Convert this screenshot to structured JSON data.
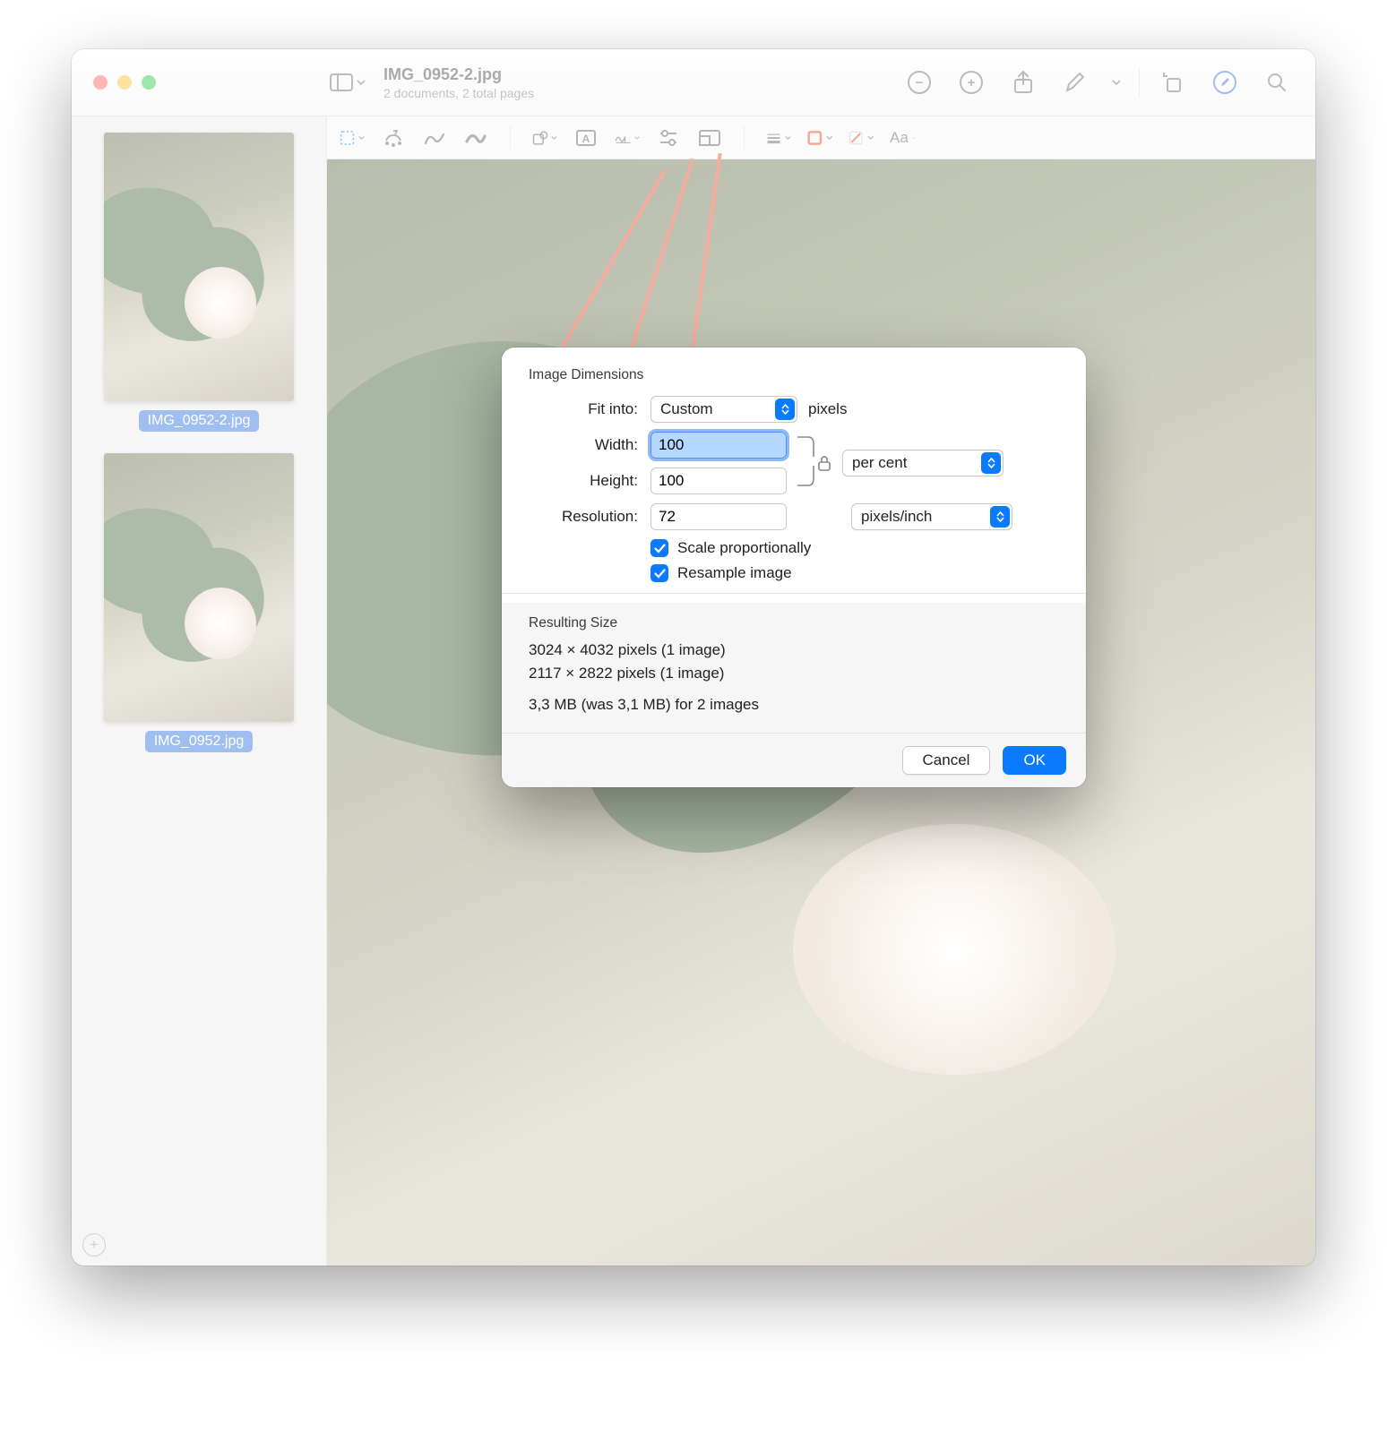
{
  "titlebar": {
    "filename": "IMG_0952-2.jpg",
    "subtitle": "2 documents, 2 total pages"
  },
  "sidebar": {
    "thumbs": [
      {
        "label": "IMG_0952-2.jpg"
      },
      {
        "label": "IMG_0952.jpg"
      }
    ]
  },
  "modal": {
    "section_label": "Image Dimensions",
    "fit_into_label": "Fit into:",
    "fit_into_value": "Custom",
    "fit_into_unit": "pixels",
    "width_label": "Width:",
    "width_value": "100",
    "height_label": "Height:",
    "height_value": "100",
    "wh_unit": "per cent",
    "resolution_label": "Resolution:",
    "resolution_value": "72",
    "resolution_unit": "pixels/inch",
    "scale_label": "Scale proportionally",
    "resample_label": "Resample image",
    "result_section": "Resulting Size",
    "result_line1": "3024 × 4032 pixels (1 image)",
    "result_line2": "2117 × 2822 pixels (1 image)",
    "result_line3": "3,3 MB (was 3,1 MB) for 2 images",
    "cancel": "Cancel",
    "ok": "OK"
  }
}
